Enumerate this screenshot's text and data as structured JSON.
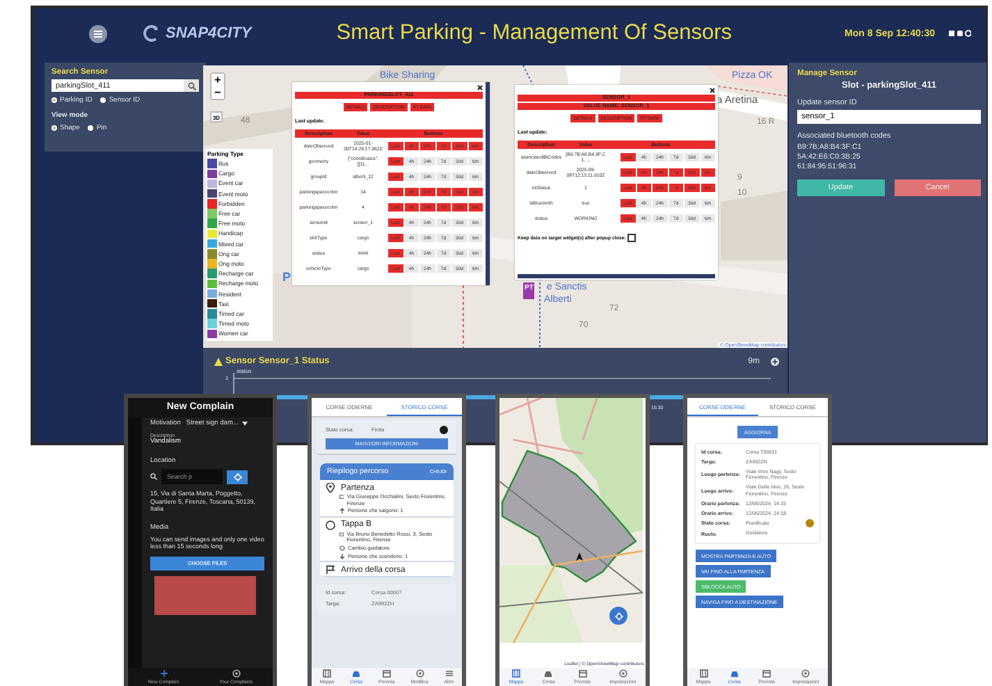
{
  "dashboard": {
    "header": {
      "logo": "SNAP4CITY",
      "title": "Smart Parking - Management Of Sensors",
      "datetime": "Mon 8 Sep 12:40:30"
    },
    "search_panel": {
      "title": "Search Sensor",
      "value": "parkingSlot_411",
      "id_options": [
        {
          "label": "Parking ID",
          "selected": true
        },
        {
          "label": "Sensor ID",
          "selected": false
        }
      ],
      "view_mode_label": "View mode",
      "view_options": [
        {
          "label": "Shape",
          "selected": true
        },
        {
          "label": "Pin",
          "selected": false
        }
      ]
    },
    "map": {
      "zoom_in": "+",
      "zoom_out": "−",
      "view_3d": "3D",
      "labels": [
        {
          "text": "Bike Sharing",
          "kind": "poi"
        },
        {
          "text": "Pizza OK",
          "kind": "poi"
        },
        {
          "text": "a Aretina",
          "kind": "street"
        },
        {
          "text": "48",
          "kind": "number"
        },
        {
          "text": "16 R",
          "kind": "number"
        },
        {
          "text": "9",
          "kind": "number"
        },
        {
          "text": "10",
          "kind": "number"
        },
        {
          "text": "72",
          "kind": "number"
        },
        {
          "text": "70",
          "kind": "number"
        },
        {
          "text": "P",
          "kind": "parking"
        },
        {
          "text": "PT",
          "kind": "pin"
        },
        {
          "text": "e Sanctis",
          "kind": "poi"
        },
        {
          "text": "Alberti",
          "kind": "poi"
        }
      ],
      "attribution": "© OpenStreetMap contributors",
      "legend": {
        "title": "Parking Type",
        "items": [
          {
            "label": "Bus",
            "color": "#4b4ba6"
          },
          {
            "label": "Cargo",
            "color": "#7b3f9e"
          },
          {
            "label": "Event car",
            "color": "#bdb6dd"
          },
          {
            "label": "Event moto",
            "color": "#4a4470"
          },
          {
            "label": "Forbidden",
            "color": "#e82424"
          },
          {
            "label": "Free car",
            "color": "#7cc96a"
          },
          {
            "label": "Free moto",
            "color": "#2fa64a"
          },
          {
            "label": "Handicap",
            "color": "#e8e83a"
          },
          {
            "label": "Mixed car",
            "color": "#3aa8e0"
          },
          {
            "label": "Ong car",
            "color": "#8c8a2a"
          },
          {
            "label": "Ong moto",
            "color": "#e8b824"
          },
          {
            "label": "Recharge car",
            "color": "#2a9a70"
          },
          {
            "label": "Recharge moto",
            "color": "#5cbd3a"
          },
          {
            "label": "Resident",
            "color": "#7aaee0"
          },
          {
            "label": "Taxi",
            "color": "#3a1d0a"
          },
          {
            "label": "Timed car",
            "color": "#2a8a9a"
          },
          {
            "label": "Timed moto",
            "color": "#6ad0d8"
          },
          {
            "label": "Women car",
            "color": "#8a3aa0"
          }
        ]
      },
      "popups": [
        {
          "title": "PARKINGSLOT_411",
          "tabs": [
            "DETAILS",
            "DESCRIPTION",
            "RT DATA"
          ],
          "last_update": "Last update:",
          "columns": [
            "Description",
            "Value",
            "Buttons"
          ],
          "rows": [
            {
              "name": "dateObserved",
              "value": "2025-01-09T14:29:17.962Z",
              "ranges": [
                {
                  "label": "Last",
                  "on": true
                },
                {
                  "label": "4h",
                  "on": true
                },
                {
                  "label": "24h",
                  "on": true
                },
                {
                  "label": "7d",
                  "on": true
                },
                {
                  "label": "30d",
                  "on": true
                },
                {
                  "label": "6m",
                  "on": true
                }
              ]
            },
            {
              "name": "geometry",
              "value": "{\"coordinates\": [[11...",
              "ranges": [
                {
                  "label": "Last",
                  "on": true
                },
                {
                  "label": "4h",
                  "on": false
                },
                {
                  "label": "24h",
                  "on": false
                },
                {
                  "label": "7d",
                  "on": false
                },
                {
                  "label": "30d",
                  "on": false
                },
                {
                  "label": "6m",
                  "on": false
                }
              ]
            },
            {
              "name": "groupId",
              "value": "alberti_12",
              "ranges": [
                {
                  "label": "Last",
                  "on": true
                },
                {
                  "label": "4h",
                  "on": false
                },
                {
                  "label": "24h",
                  "on": false
                },
                {
                  "label": "7d",
                  "on": false
                },
                {
                  "label": "30d",
                  "on": false
                },
                {
                  "label": "6m",
                  "on": false
                }
              ]
            },
            {
              "name": "parkingspacecolor",
              "value": "14",
              "ranges": [
                {
                  "label": "Last",
                  "on": true
                },
                {
                  "label": "4h",
                  "on": true
                },
                {
                  "label": "24h",
                  "on": true
                },
                {
                  "label": "7d",
                  "on": true
                },
                {
                  "label": "30d",
                  "on": true
                },
                {
                  "label": "6m",
                  "on": true
                }
              ]
            },
            {
              "name": "parkingspacecolor",
              "value": "4",
              "ranges": [
                {
                  "label": "Last",
                  "on": true
                },
                {
                  "label": "4h",
                  "on": true
                },
                {
                  "label": "24h",
                  "on": true
                },
                {
                  "label": "7d",
                  "on": true
                },
                {
                  "label": "30d",
                  "on": true
                },
                {
                  "label": "6m",
                  "on": true
                }
              ]
            },
            {
              "name": "sensorid",
              "value": "sensor_1",
              "ranges": [
                {
                  "label": "Last",
                  "on": true
                },
                {
                  "label": "4h",
                  "on": false
                },
                {
                  "label": "24h",
                  "on": false
                },
                {
                  "label": "7d",
                  "on": false
                },
                {
                  "label": "30d",
                  "on": false
                },
                {
                  "label": "6m",
                  "on": false
                }
              ]
            },
            {
              "name": "slotType",
              "value": "cargo",
              "ranges": [
                {
                  "label": "Last",
                  "on": true
                },
                {
                  "label": "4h",
                  "on": false
                },
                {
                  "label": "24h",
                  "on": false
                },
                {
                  "label": "7d",
                  "on": false
                },
                {
                  "label": "30d",
                  "on": false
                },
                {
                  "label": "6m",
                  "on": false
                }
              ]
            },
            {
              "name": "status",
              "value": "####",
              "ranges": [
                {
                  "label": "Last",
                  "on": true
                },
                {
                  "label": "4h",
                  "on": false
                },
                {
                  "label": "24h",
                  "on": false
                },
                {
                  "label": "7d",
                  "on": false
                },
                {
                  "label": "30d",
                  "on": false
                },
                {
                  "label": "6m",
                  "on": false
                }
              ]
            },
            {
              "name": "vehicleType",
              "value": "cargo",
              "ranges": [
                {
                  "label": "Last",
                  "on": true
                },
                {
                  "label": "4h",
                  "on": false
                },
                {
                  "label": "24h",
                  "on": false
                },
                {
                  "label": "7d",
                  "on": false
                },
                {
                  "label": "30d",
                  "on": false
                },
                {
                  "label": "6m",
                  "on": false
                }
              ]
            }
          ]
        },
        {
          "title": "SENSOR_1",
          "subtitle": "VALUE NAME: SENSOR_1",
          "tabs": [
            "DETAILS",
            "DESCRIPTION",
            "RT DATA"
          ],
          "last_update": "Last update:",
          "columns": [
            "Description",
            "Value",
            "Buttons"
          ],
          "rows": [
            {
              "name": "associatedBtCodes",
              "value": "[B9:7B:A8:B4:3F:C1, ...",
              "ranges": [
                {
                  "label": "Last",
                  "on": true
                },
                {
                  "label": "4h",
                  "on": false
                },
                {
                  "label": "24h",
                  "on": false
                },
                {
                  "label": "7d",
                  "on": false
                },
                {
                  "label": "30d",
                  "on": false
                },
                {
                  "label": "6m",
                  "on": false
                }
              ]
            },
            {
              "name": "dateObserved",
              "value": "2025-09-08T12:15:11.910Z",
              "ranges": [
                {
                  "label": "Last",
                  "on": true
                },
                {
                  "label": "4h",
                  "on": true
                },
                {
                  "label": "24h",
                  "on": true
                },
                {
                  "label": "7d",
                  "on": true
                },
                {
                  "label": "30d",
                  "on": true
                },
                {
                  "label": "6m",
                  "on": true
                }
              ]
            },
            {
              "name": "intStatus",
              "value": "1",
              "ranges": [
                {
                  "label": "Last",
                  "on": true
                },
                {
                  "label": "4h",
                  "on": true
                },
                {
                  "label": "24h",
                  "on": true
                },
                {
                  "label": "7d",
                  "on": true
                },
                {
                  "label": "30d",
                  "on": true
                },
                {
                  "label": "6m",
                  "on": true
                }
              ]
            },
            {
              "name": "isBluetooth",
              "value": "true",
              "ranges": [
                {
                  "label": "Last",
                  "on": true
                },
                {
                  "label": "4h",
                  "on": false
                },
                {
                  "label": "24h",
                  "on": false
                },
                {
                  "label": "7d",
                  "on": false
                },
                {
                  "label": "30d",
                  "on": false
                },
                {
                  "label": "6m",
                  "on": false
                }
              ]
            },
            {
              "name": "status",
              "value": "WORKING",
              "ranges": [
                {
                  "label": "Last",
                  "on": true
                },
                {
                  "label": "4h",
                  "on": false
                },
                {
                  "label": "24h",
                  "on": false
                },
                {
                  "label": "7d",
                  "on": false
                },
                {
                  "label": "30d",
                  "on": false
                },
                {
                  "label": "6m",
                  "on": false
                }
              ]
            }
          ],
          "keep_data": {
            "label": "Keep data on target widget(s) after popup close:",
            "checked": false
          }
        }
      ]
    },
    "status_panel": {
      "title": "Sensor Sensor_1 Status",
      "period": "9m",
      "y_tick": "3",
      "series_label": "status",
      "x_tick": "15:30"
    },
    "manage_panel": {
      "title": "Manage Sensor",
      "slot": "Slot - parkingSlot_411",
      "field_label": "Update sensor ID",
      "value": "sensor_1",
      "codes_label": "Associated bluetooth codes",
      "codes": [
        "B9:7B:A8:B4:3F:C1",
        "5A:42:E6:C0:3B:25",
        "61:84:95:51:96:31"
      ],
      "buttons": [
        {
          "label": "Update",
          "kind": "confirm"
        },
        {
          "label": "Cancel",
          "kind": "cancel"
        }
      ]
    }
  },
  "phones": [
    {
      "kind": "complain",
      "title": "New Complain",
      "motivation_label": "Motivation",
      "motivation": "Street sign dam...",
      "description_label": "Description",
      "description": "Vandalism",
      "location_label": "Location",
      "search_placeholder": "Search p",
      "address": "15, Via di Santa Marta, Poggetto, Quartiere 5, Firenze, Toscana, 50139, Italia",
      "media_label": "Media",
      "media_hint": "You can send images and only one video less than 15 seconds long",
      "choose_files": "CHOOSE FILES",
      "nav": [
        {
          "label": "New Complain",
          "selected": true
        },
        {
          "label": "Your Complains",
          "selected": false
        }
      ]
    },
    {
      "kind": "history",
      "tabs": [
        {
          "label": "CORSE ODIERNE",
          "selected": false
        },
        {
          "label": "STORICO CORSE",
          "selected": true
        }
      ],
      "status": {
        "label": "Stato corsa:",
        "value": "Finita",
        "color": "#1a1a1a"
      },
      "more_info": "MAGGIORI INFORMAZIONI",
      "summary": {
        "title": "Riepilogo percorso",
        "close": "CHIUDI",
        "stops": [
          {
            "kind": "start",
            "title": "Partenza",
            "address": "Via Giuseppe Occhialini, Sesto Fiorentino, Firenze",
            "details": [
              {
                "kind": "board",
                "text": "Persone che salgono: 1"
              }
            ]
          },
          {
            "kind": "stop",
            "title": "Tappa B",
            "address": "Via Bruno Benedetto Rossi, 3, Sesto Fiorentino, Firenze",
            "details": [
              {
                "kind": "driver",
                "text": "Cambio guidatore"
              },
              {
                "kind": "alight",
                "text": "Persone che scendono: 1"
              }
            ]
          },
          {
            "kind": "end",
            "title": "Arrivo della corsa"
          }
        ]
      },
      "rows": [
        {
          "label": "Id corsa:",
          "value": "Corsa 00007"
        },
        {
          "label": "Targa:",
          "value": "ZA992ZH"
        }
      ],
      "nav": [
        {
          "label": "Mappa",
          "selected": false
        },
        {
          "label": "Corsa",
          "selected": true
        },
        {
          "label": "Prenota",
          "selected": false
        },
        {
          "label": "Modifica",
          "selected": false
        },
        {
          "label": "Altro",
          "selected": false
        }
      ]
    },
    {
      "kind": "map",
      "attribution": "Leaflet | © OpenStreetMap contributors",
      "nav": [
        {
          "label": "Mappa",
          "selected": true
        },
        {
          "label": "Corsa",
          "selected": false
        },
        {
          "label": "Prenota",
          "selected": false
        },
        {
          "label": "Impostazioni",
          "selected": false
        }
      ]
    },
    {
      "kind": "today",
      "tabs": [
        {
          "label": "CORSE ODIERNE",
          "selected": true
        },
        {
          "label": "STORICO CORSE",
          "selected": false
        }
      ],
      "refresh": "AGGIORNA",
      "rows": [
        {
          "label": "Id corsa:",
          "value": "Corsa T00011"
        },
        {
          "label": "Targa:",
          "value": "ZA992ZH"
        },
        {
          "label": "Luogo partenza:",
          "value": "Viale Imre Nagy, Sesto Fiorentino, Firenze"
        },
        {
          "label": "Luogo arrivo:",
          "value": "Viale Delle Idee, 26, Sesto Fiorentino, Firenze"
        },
        {
          "label": "Orario partenza:",
          "value": "12/06/2024, 14:15"
        },
        {
          "label": "Orario arrivo:",
          "value": "12/06/2024, 14:18"
        },
        {
          "label": "Stato corsa:",
          "value": "Pianificata",
          "color": "#b8860b"
        },
        {
          "label": "Ruolo:",
          "value": "Guidatore"
        }
      ],
      "buttons": [
        {
          "label": "MOSTRA PARTENZA E AUTO",
          "kind": "primary"
        },
        {
          "label": "VAI FINO ALLA PARTENZA",
          "kind": "primary"
        },
        {
          "label": "SBLOCCA AUTO",
          "kind": "success"
        },
        {
          "label": "NAVIGA FINO A DESTINAZIONE",
          "kind": "primary"
        }
      ],
      "nav": [
        {
          "label": "Mappa",
          "selected": false
        },
        {
          "label": "Corsa",
          "selected": true
        },
        {
          "label": "Prenota",
          "selected": false
        },
        {
          "label": "Impostazioni",
          "selected": false
        }
      ]
    }
  ]
}
